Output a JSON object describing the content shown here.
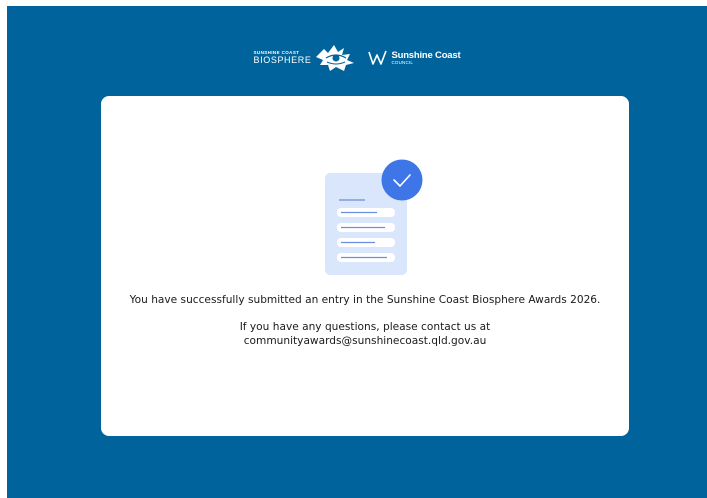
{
  "header": {
    "biosphere_logo": {
      "line1": "SUNSHINE COAST",
      "line2": "BIOSPHERE"
    },
    "council_logo": {
      "line1": "Sunshine Coast",
      "line2": "COUNCIL"
    }
  },
  "confirmation": {
    "success_message": "You have successfully submitted an entry in the Sunshine Coast Biosphere Awards 2026.",
    "contact_message": "If you have any questions, please contact us at communityawards@sunshinecoast.qld.gov.au"
  },
  "icons": {
    "document": "document-icon",
    "check": "checkmark-icon"
  },
  "colors": {
    "background": "#01639c",
    "card": "#ffffff",
    "check_badge": "#3e76e8",
    "document_fill": "#d9e6fb",
    "document_lines": "#6a8fd8"
  }
}
